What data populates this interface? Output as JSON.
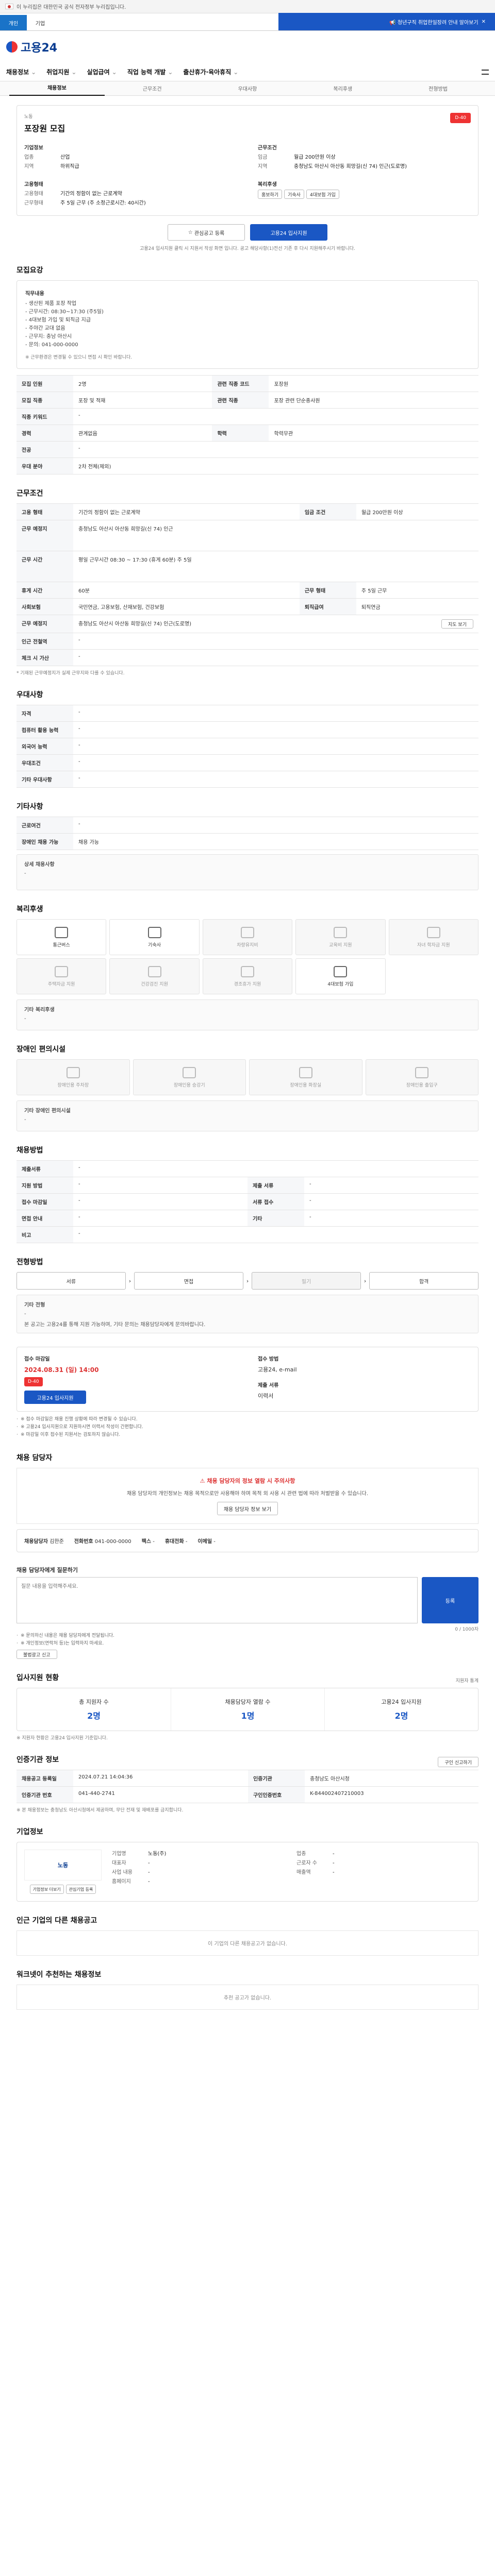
{
  "gov_banner": {
    "text": "이 누리집은 대한민국 공식 전자정부 누리집입니다."
  },
  "top_tabs": [
    {
      "label": "개인"
    },
    {
      "label": "기업"
    }
  ],
  "promo": {
    "text": "📢 청년구직 취업한일장려 안내 알아보기"
  },
  "logo": {
    "text": "고용24"
  },
  "gnb": [
    {
      "label": "채용정보"
    },
    {
      "label": "취업지원"
    },
    {
      "label": "실업급여"
    },
    {
      "label": "직업 능력 개발"
    },
    {
      "label": "출산휴가·육아휴직"
    }
  ],
  "subnav": [
    {
      "label": "채용정보"
    },
    {
      "label": "근무조건"
    },
    {
      "label": "우대사항"
    },
    {
      "label": "복리후생"
    },
    {
      "label": "전형방법"
    }
  ],
  "job": {
    "badge": "D-40",
    "title": "포장원 모집",
    "company_label": "기업정보",
    "company_name": "노동",
    "left_info": [
      {
        "k": "업종",
        "v": "산업"
      },
      {
        "k": "지역",
        "v": "하위직급"
      }
    ],
    "right_title": "근무조건",
    "right_info": [
      {
        "k": "임금",
        "v": "월급 200만원 이상"
      },
      {
        "k": "지역",
        "v": "충청남도 아산시 아산동 희망길(신 74) 인근(도로명)"
      }
    ],
    "left2_title": "고용형태",
    "left2_info": [
      {
        "k": "고용형태",
        "v": "기간의 정함이 없는 근로계약"
      },
      {
        "k": "근무형태",
        "v": "주 5일 근무 (주 소정근로시간: 40시간)"
      }
    ],
    "right2_title": "복리후생",
    "right2_tags": [
      "홍보하기",
      "기숙사",
      "4대보험 가입"
    ],
    "apply_title": "관심공고 등록",
    "apply_btn": "고용24 입사지원",
    "apply_note": "고용24 입사지원 클릭 시 지원서 작성 화면 입니다. 공고 해당사항(1)전선 기존 후 다시 지원해주시기 바랍니다."
  },
  "recruit": {
    "title": "모집요강",
    "duty_label": "직무내용",
    "duty_lines": [
      "- 생산된 제품 포장 작업",
      "- 근무시간: 08:30~17:30 (주5일)",
      "- 4대보험 가입 및 퇴직금 지급",
      "- 주야간 교대 없음",
      "- 근무지: 충남 아산시",
      "- 문의: 041-000-0000"
    ],
    "duty_note": "※ 근무환경은 변경될 수 있으니 면접 시 확인 바랍니다.",
    "rows": [
      {
        "k": "모집 인원",
        "v": "2명",
        "k2": "관련 직종 코드",
        "v2": "포장원"
      },
      {
        "k": "모집 직종",
        "v": "포장 및 적재",
        "k2": "관련 직종",
        "v2": "포장 관련 단순종사원"
      },
      {
        "k": "직종 키워드",
        "v": "-"
      },
      {
        "k": "경력",
        "v": "관계없음",
        "k2": "학력",
        "v2": "학력무관"
      },
      {
        "k": "전공",
        "v": "-"
      },
      {
        "k": "우대 분야",
        "v": "2차 전체(제외)"
      }
    ]
  },
  "work": {
    "title": "근무조건",
    "rows": [
      {
        "k": "고용 형태",
        "v": "기간의 정함이 없는 근로계약",
        "k2": "임금 조건",
        "v2": "월급 200만원 이상"
      },
      {
        "k": "근무 예정지",
        "v": "충청남도 아산시 아산동 희망길(신 74) 인근"
      },
      {
        "k": "근무 시간",
        "v": "평일 근무시간 08:30 ~ 17:30 (휴게 60분) 주 5일"
      },
      {
        "k": "휴게 시간",
        "v": "60분",
        "k2": "근무 형태",
        "v2": "주 5일 근무"
      },
      {
        "k": "사회보험",
        "v": "국민연금, 고용보험, 산재보험, 건강보험",
        "k2": "퇴직급여",
        "v2": "퇴직연금"
      },
      {
        "k": "근무 예정지",
        "v": "충청남도 아산시 아산동 희망길(신 74) 인근(도로명)",
        "btn": "지도 보기"
      },
      {
        "k": "인근 전철역",
        "v": "-"
      },
      {
        "k": "체크 시 가산",
        "v": "-"
      }
    ],
    "note": "* 기재된 근무예정지가 실제 근무지와 다를 수 있습니다."
  },
  "prefer": {
    "title": "우대사항",
    "rows": [
      {
        "k": "자격",
        "v": "-"
      },
      {
        "k": "컴퓨터 활용 능력",
        "v": "-"
      },
      {
        "k": "외국어 능력",
        "v": "-"
      },
      {
        "k": "우대조건",
        "v": "-"
      },
      {
        "k": "기타 우대사항",
        "v": "-"
      }
    ]
  },
  "other": {
    "title": "기타사항",
    "rows": [
      {
        "k": "근로여건",
        "v": "-"
      },
      {
        "k": "장애인 채용 가능",
        "v": "채용 가능"
      }
    ],
    "detail_label": "상세 채용사항",
    "detail_value": "-"
  },
  "welfare": {
    "title": "복리후생",
    "items": [
      {
        "label": "통근버스",
        "on": true
      },
      {
        "label": "기숙사",
        "on": true
      },
      {
        "label": "차량유지비",
        "on": false
      },
      {
        "label": "교육비 지원",
        "on": false
      },
      {
        "label": "자녀 학자금 지원",
        "on": false
      },
      {
        "label": "주택자금 지원",
        "on": false
      },
      {
        "label": "건강검진 지원",
        "on": false
      },
      {
        "label": "경조휴가 지원",
        "on": false
      },
      {
        "label": "4대보험 가입",
        "on": true
      },
      {
        "label": "",
        "on": false
      }
    ],
    "other_label": "기타 복리후생",
    "other_value": "-"
  },
  "disabled": {
    "title": "장애인 편의시설",
    "items": [
      {
        "label": "장애인용 주차장"
      },
      {
        "label": "장애인용 승강기"
      },
      {
        "label": "장애인용 화장실"
      },
      {
        "label": "장애인용 출입구"
      }
    ],
    "other_label": "기타 장애인 편의시설",
    "other_value": "-"
  },
  "recruit_apply": {
    "title": "채용방법",
    "rows": [
      {
        "k": "제출서류",
        "v": "-"
      },
      {
        "k": "지원 방법",
        "v": "-",
        "k2": "제출 서류",
        "v2": "-"
      },
      {
        "k": "접수 마감일",
        "v": "-",
        "k2": "서류 접수",
        "v2": "-"
      },
      {
        "k": "면접 안내",
        "v": "-",
        "k2": "기타",
        "v2": "-"
      },
      {
        "k": "비고",
        "v": "-"
      }
    ]
  },
  "process": {
    "title": "전형방법",
    "steps": [
      "서류",
      "면접",
      "필기",
      "합격"
    ],
    "other_label": "기타 전형",
    "other_value": "-",
    "extra": "본 공고는 고용24를 통해 지원 가능하며, 기타 문의는 채용담당자에게 문의바랍니다."
  },
  "period": {
    "left_title": "접수 마감일",
    "date": "2024.08.31 (일) 14:00",
    "badge": "D-40",
    "apply_btn": "고용24 입사지원",
    "right_title": "접수 방법",
    "method": "고용24, e-mail",
    "docs_title": "제출 서류",
    "docs": "이력서",
    "notes": [
      "※ 접수 마감일은 채용 진행 상황에 따라 변경될 수 있습니다.",
      "※ 고용24 입사지원으로 지원하시면 이력서 작성이 간편합니다.",
      "※ 마감일 이후 접수된 지원서는 검토하지 않습니다."
    ]
  },
  "contact": {
    "title": "채용 담당자",
    "warn_title": "채용 담당자의 정보 열람 시 주의사항",
    "warn_text": "채용 담당자의 개인정보는 채용 목적으로만 사용해야 하며 목적 외 사용 시 관련 법에 따라 처벌받을 수 있습니다.",
    "warn_btn": "채용 담당자 정보 보기",
    "name_label": "채용담당자",
    "name": "김한준",
    "phone_label": "전화번호",
    "phone": "041-000-0000",
    "fax_label": "팩스",
    "fax": "-",
    "mobile_label": "휴대전화",
    "mobile": "-",
    "email_label": "이메일",
    "email": "-"
  },
  "qna": {
    "title": "채용 담당자에게 질문하기",
    "placeholder": "질문 내용을 입력해주세요.",
    "submit": "등록",
    "counter": "0 / 1000자",
    "notes": [
      "※ 문의하신 내용은 채용 담당자에게 전달됩니다.",
      "※ 개인정보(연락처 등)는 입력하지 마세요."
    ],
    "report_btn": "불법광고 신고"
  },
  "stats": {
    "title": "입사지원 현황",
    "more": "지원자 통계",
    "items": [
      {
        "label": "총 지원자 수",
        "value": "2명"
      },
      {
        "label": "채용담당자 열람 수",
        "value": "1명"
      },
      {
        "label": "고용24 입사지원",
        "value": "2명"
      }
    ],
    "note": "※ 지원자 현황은 고용24 입사지원 기준입니다."
  },
  "info": {
    "title": "인증기관 정보",
    "rows": [
      {
        "k": "채용공고 등록일",
        "v": "2024.07.21 14:04:36",
        "k2": "인증기관",
        "v2": "충청남도 아산시청"
      },
      {
        "k": "인증기관 번호",
        "v": "041-440-2741",
        "k2": "구인인증번호",
        "v2": "K-844002407210003"
      }
    ],
    "btn": "구인 신고하기",
    "note": "※ 본 채용정보는 충청남도 아산시청에서 제공하며, 무단 전재 및 재배포를 금지합니다."
  },
  "company": {
    "title": "기업정보",
    "logo_text": "노동",
    "rows": [
      {
        "k": "기업명",
        "v": "노동(주)",
        "k2": "업종",
        "v2": "-"
      },
      {
        "k": "대표자",
        "v": "-",
        "k2": "근로자 수",
        "v2": "-"
      },
      {
        "k": "사업 내용",
        "v": "-",
        "k2": "매출액",
        "v2": "-"
      },
      {
        "k": "홈페이지",
        "v": "-"
      }
    ],
    "btn1": "기업정보 더보기",
    "btn2": "관심기업 등록"
  },
  "others": {
    "title": "인근 기업의 다른 채용공고",
    "empty": "이 기업의 다른 채용공고가 없습니다."
  },
  "recommend": {
    "title": "워크넷이 추천하는 채용정보",
    "empty": "추천 공고가 없습니다."
  }
}
